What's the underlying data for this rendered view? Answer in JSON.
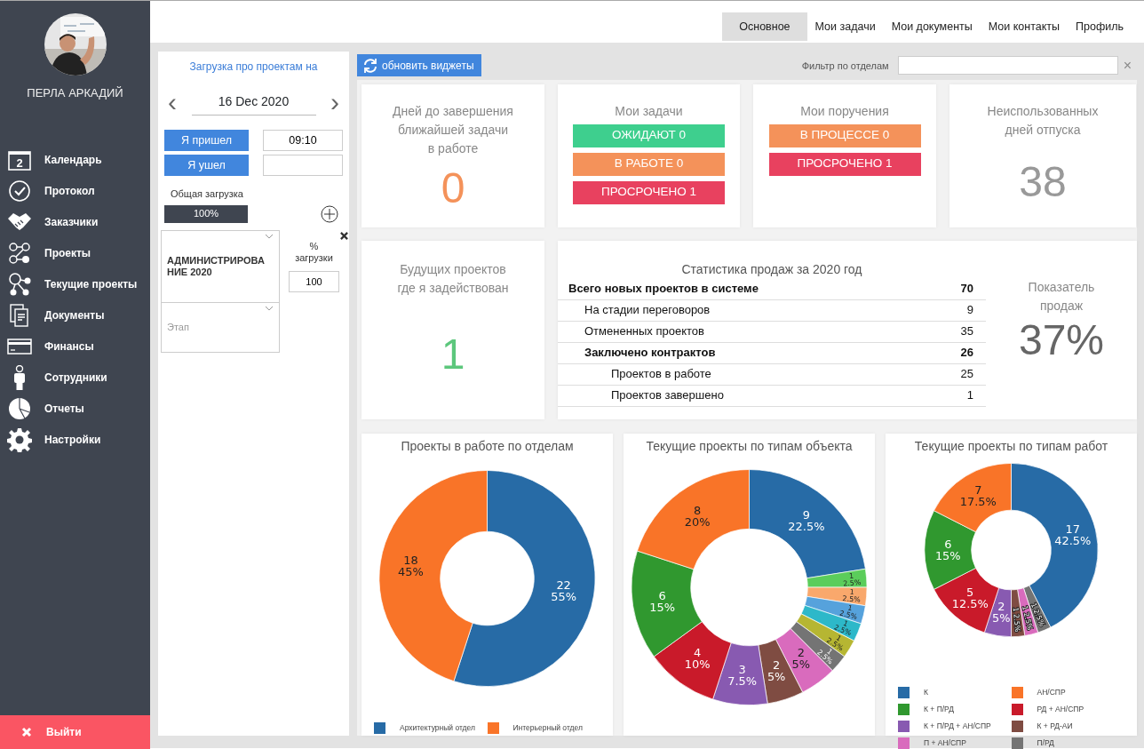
{
  "sidebar": {
    "user_name": "ПЕРЛА АРКАДИЙ",
    "items": [
      {
        "label": "Календарь",
        "icon_text": "2"
      },
      {
        "label": "Протокол"
      },
      {
        "label": "Заказчики"
      },
      {
        "label": "Проекты"
      },
      {
        "label": "Текущие проекты"
      },
      {
        "label": "Документы"
      },
      {
        "label": "Финансы"
      },
      {
        "label": "Сотрудники"
      },
      {
        "label": "Отчеты"
      },
      {
        "label": "Настройки"
      }
    ],
    "logout": "Выйти"
  },
  "tabs": [
    {
      "label": "Основное",
      "selected": true
    },
    {
      "label": "Мои задачи",
      "selected": false
    },
    {
      "label": "Мои документы",
      "selected": false
    },
    {
      "label": "Мои контакты",
      "selected": false
    },
    {
      "label": "Профиль",
      "selected": false
    }
  ],
  "workload": {
    "title": "Загрузка про проектам на",
    "prev": "‹",
    "date": "16 Dec 2020",
    "next": "›",
    "arrived_button": "Я пришел",
    "arrived_time": "09:10",
    "left_button": "Я ушел",
    "total_label": "Общая загрузка",
    "total_value": "100%",
    "project": "АДМИНИСТРИРОВАНИЕ 2020",
    "stage_placeholder": "Этап",
    "percent_label": "% загрузки",
    "percent_value": "100"
  },
  "toolbar": {
    "refresh_button": "обновить виджеты",
    "filter_label": "Фильтр по отделам",
    "filter_clear": "×"
  },
  "deadline_card": {
    "title": "Дней до завершения\nближайшей задачи\nв работе",
    "value": "0"
  },
  "tasks_card": {
    "title": "Мои задачи",
    "badges": [
      {
        "label": "ОЖИДАЮТ 0",
        "color": "#3ecf8e"
      },
      {
        "label": "В РАБОТЕ 0",
        "color": "#f4925a"
      },
      {
        "label": "ПРОСРОЧЕНО 1",
        "color": "#e8415f"
      }
    ]
  },
  "orders_card": {
    "title": "Мои поручения",
    "badges": [
      {
        "label": "В ПРОЦЕССЕ 0",
        "color": "#f4925a"
      },
      {
        "label": "ПРОСРОЧЕНО 1",
        "color": "#e8415f"
      }
    ]
  },
  "vacation_card": {
    "title": "Неиспользованных\nдней отпуска",
    "value": "38"
  },
  "future_card": {
    "title": "Будущих проектов\nгде я задействован",
    "value": "1"
  },
  "sales_card": {
    "title": "Статистика продаж за 2020 год",
    "rows": [
      {
        "label": "Всего новых проектов в системе",
        "value": "70",
        "bold": true,
        "children": [
          {
            "label": "На стадии переговоров",
            "value": "9",
            "bold": false
          },
          {
            "label": "Отмененных проектов",
            "value": "35",
            "bold": false
          },
          {
            "label": "Заключено контрактов",
            "value": "26",
            "bold": true,
            "children": [
              {
                "label": "Проектов в работе",
                "value": "25",
                "bold": false
              },
              {
                "label": "Проектов завершено",
                "value": "1",
                "bold": false
              }
            ]
          }
        ]
      }
    ],
    "indicator_title": "Показатель\nпродаж",
    "indicator_value": "37%"
  },
  "charts": [
    {
      "title": "Проекты в работе по отделам",
      "chart_data": {
        "type": "donut",
        "categories": [
          "Архитектурный отдел",
          "Интерьерный отдел"
        ],
        "values": [
          22,
          18
        ],
        "colors": [
          "#276ba6",
          "#f97428"
        ],
        "value_labels": [
          "22\n55%",
          "18\n45%"
        ]
      }
    },
    {
      "title": "Текущие проекты по типам объекта",
      "chart_data": {
        "type": "donut",
        "values": [
          9,
          1,
          1,
          1,
          1,
          1,
          1,
          2,
          2,
          3,
          4,
          6,
          8
        ],
        "colors": [
          "#276ba6",
          "#5bcd5b",
          "#f9a86c",
          "#56a2dc",
          "#2db8c9",
          "#b6b632",
          "#747474",
          "#d96bbd",
          "#7f4c42",
          "#885ab1",
          "#c91a2a",
          "#30982f",
          "#f97428"
        ],
        "value_labels": [
          "9\n22.5%",
          "1\n2.5%",
          "1\n2.5%",
          "1\n2.5%",
          "1\n2.5%",
          "1\n2.5%",
          "1\n2.5%",
          "2\n5%",
          "2\n5%",
          "3\n7.5%",
          "4\n10%",
          "6\n15%",
          "8\n20%"
        ]
      }
    },
    {
      "title": "Текущие проекты по типам работ",
      "chart_data": {
        "type": "donut",
        "categories": [
          "К",
          "П/РД",
          "П + АН/СПР",
          "К + РД-АИ",
          "К + П/РД + АН/СПР",
          "РД + АН/СПР",
          "К + П/РД",
          "АН/СПР"
        ],
        "values": [
          17,
          1,
          1,
          1,
          2,
          5,
          6,
          7
        ],
        "colors": [
          "#276ba6",
          "#747474",
          "#d96bbd",
          "#7f4c42",
          "#885ab1",
          "#c91a2a",
          "#30982f",
          "#f97428"
        ],
        "value_labels": [
          "17\n42.5%",
          "1\n2.5%",
          "1\n2.5%",
          "1\n2.5%",
          "2\n5%",
          "5\n12.5%",
          "6\n15%",
          "7\n17.5%"
        ]
      }
    }
  ]
}
